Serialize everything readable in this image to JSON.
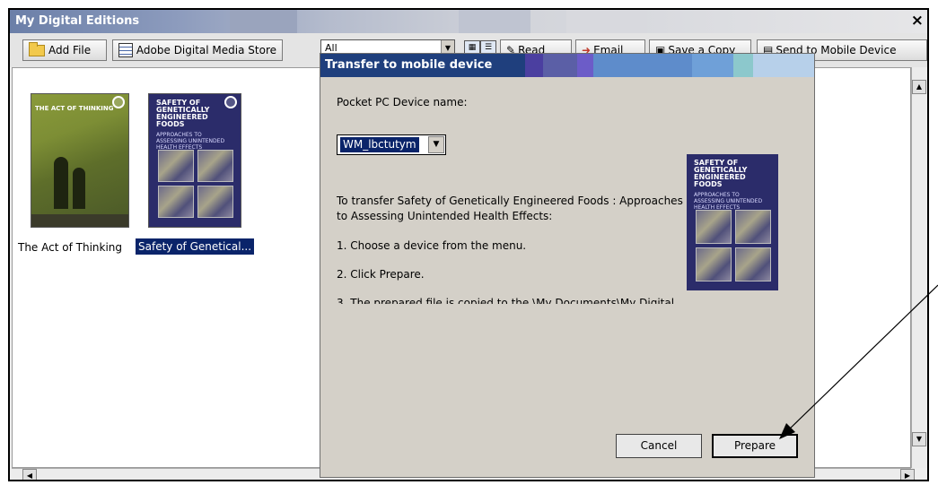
{
  "app": {
    "title": "My Digital Editions",
    "close_glyph": "×"
  },
  "toolbar": {
    "add_file": "Add File",
    "store": "Adobe Digital Media Store",
    "filter_value": "All",
    "read_partial": "Read",
    "email_partial": "Email",
    "save_copy_partial": "Save a Copy",
    "send_mobile_partial": "Send to Mobile Device"
  },
  "library": {
    "books": [
      {
        "label": "The Act of Thinking",
        "cover_text": "THE ACT OF THINKING"
      },
      {
        "label": "Safety of Genetical...",
        "cover_title": "SAFETY OF GENETICALLY ENGINEERED FOODS",
        "cover_subtitle": "APPROACHES TO ASSESSING UNINTENDED HEALTH EFFECTS"
      }
    ]
  },
  "dialog": {
    "title": "Transfer to mobile device",
    "device_label": "Pocket PC Device name:",
    "device_value": "WM_lbctutym",
    "instructions_line1": "To transfer Safety of Genetically Engineered Foods : Approaches",
    "instructions_line2": "to Assessing Unintended Health Effects:",
    "step1": "1. Choose a device from the menu.",
    "step2": "2. Click Prepare.",
    "step3_partial": "3. The prepared file is copied to the \\My Documents\\My Digital",
    "cancel_label": "Cancel",
    "prepare_label": "Prepare",
    "cover_title": "SAFETY OF GENETICALLY ENGINEERED FOODS",
    "cover_subtitle": "APPROACHES TO ASSESSING UNINTENDED HEALTH EFFECTS"
  },
  "colors": {
    "title_bar": "#6b7fa8",
    "dialog_title": "#1f3f7d",
    "selection": "#0a246a",
    "dialog_bg": "#d4d0c8"
  }
}
